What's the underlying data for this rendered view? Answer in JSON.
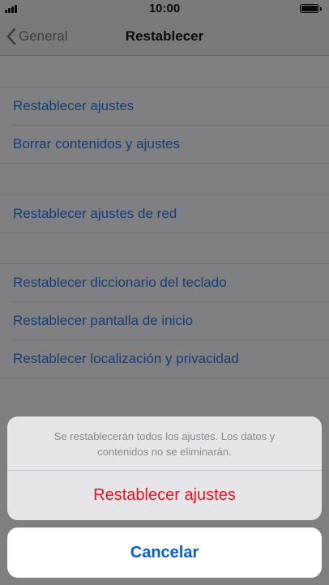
{
  "status_bar": {
    "time": "10:00",
    "battery_level": 1.0
  },
  "nav": {
    "back_label": "General",
    "title": "Restablecer"
  },
  "list": {
    "reset_settings": "Restablecer ajustes",
    "erase_content": "Borrar contenidos y ajustes",
    "reset_network": "Restablecer ajustes de red",
    "reset_keyboard_dictionary": "Restablecer diccionario del teclado",
    "reset_home_screen": "Restablecer pantalla de inicio",
    "reset_location_privacy": "Restablecer localización y privacidad"
  },
  "action_sheet": {
    "message": "Se restablecerán todos los ajustes. Los datos y contenidos no se eliminarán.",
    "confirm_label": "Restablecer ajustes",
    "cancel_label": "Cancelar"
  },
  "colors": {
    "link_blue": "#0b5dd6",
    "destructive_red": "#e8121e",
    "dim_overlay": "#7f7f81"
  }
}
